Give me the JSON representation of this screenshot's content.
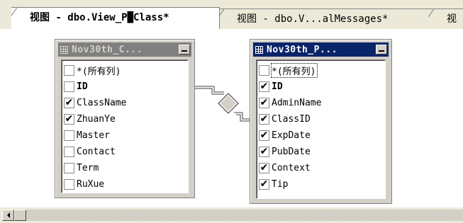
{
  "tabs": [
    {
      "label": "视图 - dbo.View_P█Class*",
      "active": true
    },
    {
      "label": "视图 - dbo.V...alMessages*",
      "active": false
    },
    {
      "label": "视",
      "active": false
    }
  ],
  "left_table": {
    "title": "Nov30th_C...",
    "columns": [
      {
        "name": "*(所有列)",
        "checked": false
      },
      {
        "name": "ID",
        "checked": false,
        "bold": true
      },
      {
        "name": "ClassName",
        "checked": true
      },
      {
        "name": "ZhuanYe",
        "checked": true
      },
      {
        "name": "Master",
        "checked": false
      },
      {
        "name": "Contact",
        "checked": false
      },
      {
        "name": "Term",
        "checked": false
      },
      {
        "name": "RuXue",
        "checked": false
      }
    ]
  },
  "right_table": {
    "title": "Nov30th_P...",
    "columns": [
      {
        "name": "*(所有列)",
        "checked": false,
        "focused": true
      },
      {
        "name": "ID",
        "checked": true,
        "bold": true
      },
      {
        "name": "AdminName",
        "checked": true
      },
      {
        "name": "ClassID",
        "checked": true
      },
      {
        "name": "ExpDate",
        "checked": true
      },
      {
        "name": "PubDate",
        "checked": true
      },
      {
        "name": "Context",
        "checked": true
      },
      {
        "name": "Tip",
        "checked": true
      }
    ]
  },
  "checkmark": "✔",
  "colors": {
    "active_title": "#0a246a",
    "inactive_title": "#808080",
    "chrome": "#d4d0c8"
  },
  "icons": [
    "grid-icon",
    "minimize-icon",
    "join-diamond-icon",
    "scroll-left-arrow-icon"
  ]
}
